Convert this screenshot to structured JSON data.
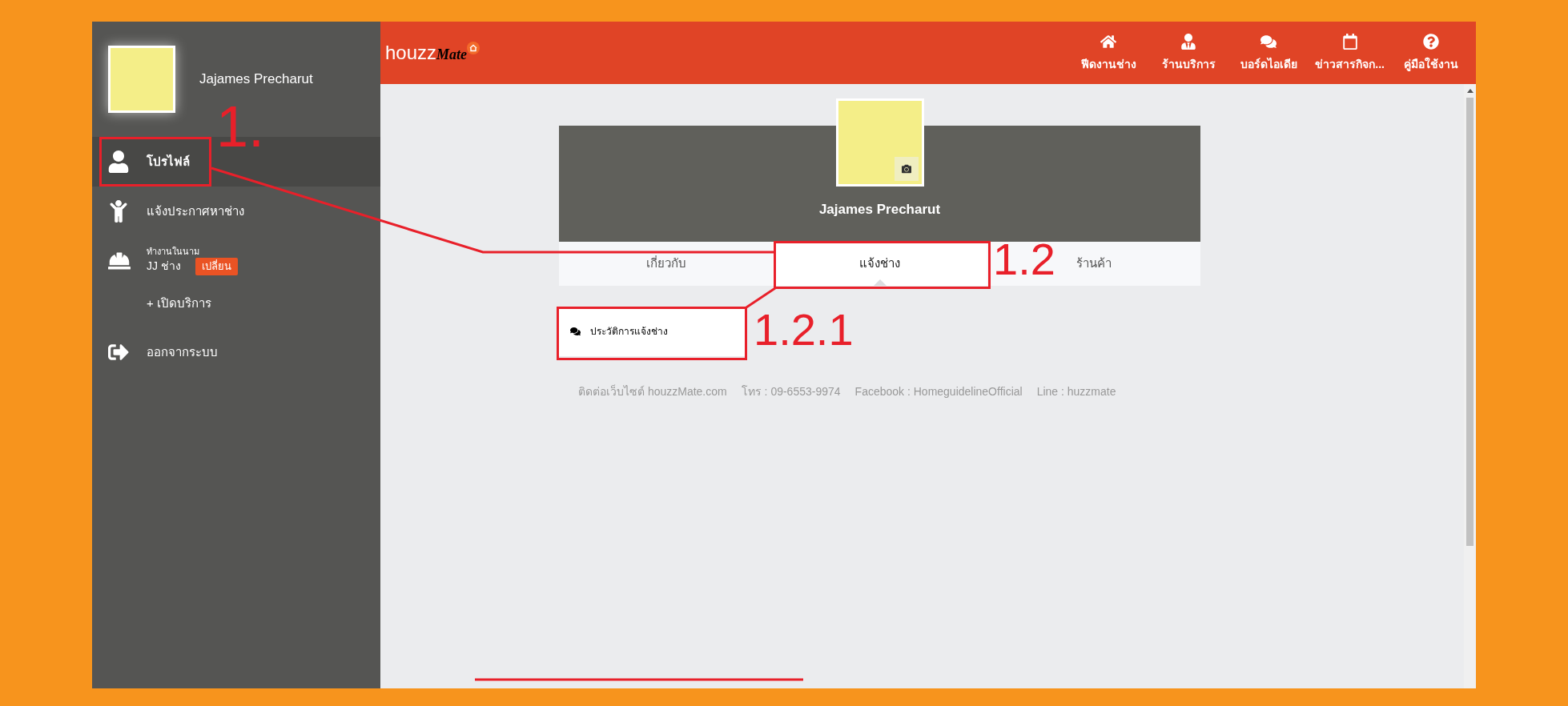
{
  "sidebar": {
    "user_name": "Jajames Precharut",
    "items": [
      {
        "kind": "nav",
        "label": "โปรไฟล์",
        "selected": true
      },
      {
        "kind": "nav",
        "label": "แจ้งประกาศหาช่าง",
        "selected": false
      },
      {
        "kind": "account",
        "caption": "ทำงานในนาม",
        "label": "JJ ช่าง",
        "button": "เปลี่ยน"
      },
      {
        "kind": "add",
        "label": "+ เปิดบริการ"
      },
      {
        "kind": "nav",
        "label": "ออกจากระบบ",
        "selected": false
      }
    ]
  },
  "header": {
    "logo": {
      "part_1": "houzz",
      "part_2": "Mate"
    },
    "nav": [
      {
        "label": "ฟีดงานช่าง"
      },
      {
        "label": "ร้านบริการ"
      },
      {
        "label": "บอร์ดไอเดีย"
      },
      {
        "label": "ข่าวสารกิจก..."
      },
      {
        "label": "คู่มือใช้งาน"
      }
    ]
  },
  "profile": {
    "name": "Jajames Precharut",
    "tabs": [
      {
        "label": "เกี่ยวกับ",
        "selected": false
      },
      {
        "label": "แจ้งช่าง",
        "selected": true
      },
      {
        "label": "ร้านค้า",
        "selected": false
      }
    ],
    "sub_items": [
      {
        "label": "ประวัติการแจ้งช่าง"
      }
    ],
    "footer": [
      "ติดต่อเว็บไซต์ houzzMate.com",
      "โทร : 09-6553-9974",
      "Facebook : HomeguidelineOfficial",
      "Line : huzzmate"
    ]
  },
  "annotations": [
    {
      "label": "1."
    },
    {
      "label": "1.2"
    },
    {
      "label": "1.2.1"
    }
  ]
}
